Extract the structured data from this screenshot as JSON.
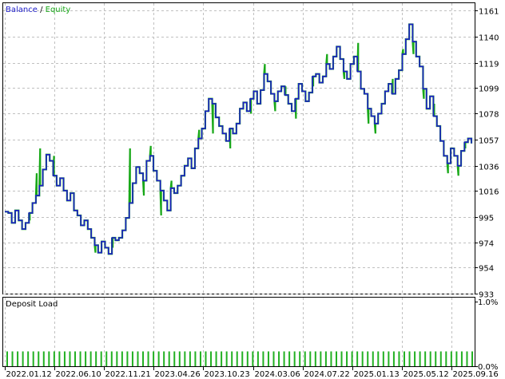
{
  "legend": {
    "balance_label": "Balance",
    "separator": " / ",
    "equity_label": "Equity",
    "balance_color": "#1c1cc8",
    "equity_color": "#18a818"
  },
  "panel2": {
    "title": "Deposit Load"
  },
  "colors": {
    "grid": "#c0c0c0",
    "axis": "#000000",
    "background": "#ffffff",
    "bar": "#22b022"
  },
  "chart_data": [
    {
      "type": "line",
      "title": "",
      "series_labels": [
        "Balance",
        "Equity"
      ],
      "ylim": [
        933,
        1167
      ],
      "yticks": [
        1161,
        1140,
        1119,
        1099,
        1078,
        1057,
        1036,
        1016,
        995,
        974,
        954,
        933
      ],
      "xticks": [
        "2022.01.12",
        "2022.06.10",
        "2022.11.21",
        "2023.04.26",
        "2023.10.23",
        "2024.03.06",
        "2024.07.22",
        "2025.01.13",
        "2025.05.12",
        "2025.09.16"
      ],
      "grid": true,
      "legend_position": "top-left",
      "balance_points": [
        [
          0,
          999
        ],
        [
          2,
          998
        ],
        [
          4,
          990
        ],
        [
          6,
          1000
        ],
        [
          8,
          992
        ],
        [
          10,
          985
        ],
        [
          12,
          990
        ],
        [
          14,
          998
        ],
        [
          16,
          1006
        ],
        [
          18,
          1012
        ],
        [
          20,
          1020
        ],
        [
          22,
          1033
        ],
        [
          24,
          1045
        ],
        [
          26,
          1040
        ],
        [
          28,
          1028
        ],
        [
          30,
          1020
        ],
        [
          32,
          1026
        ],
        [
          34,
          1016
        ],
        [
          36,
          1008
        ],
        [
          38,
          1014
        ],
        [
          40,
          1000
        ],
        [
          42,
          996
        ],
        [
          44,
          988
        ],
        [
          46,
          992
        ],
        [
          48,
          985
        ],
        [
          50,
          978
        ],
        [
          52,
          972
        ],
        [
          54,
          966
        ],
        [
          56,
          975
        ],
        [
          58,
          970
        ],
        [
          60,
          965
        ],
        [
          62,
          978
        ],
        [
          64,
          976
        ],
        [
          66,
          978
        ],
        [
          68,
          984
        ],
        [
          70,
          994
        ],
        [
          72,
          1006
        ],
        [
          74,
          1022
        ],
        [
          76,
          1035
        ],
        [
          78,
          1030
        ],
        [
          80,
          1024
        ],
        [
          82,
          1040
        ],
        [
          84,
          1044
        ],
        [
          86,
          1032
        ],
        [
          88,
          1024
        ],
        [
          90,
          1016
        ],
        [
          92,
          1008
        ],
        [
          94,
          1000
        ],
        [
          96,
          1018
        ],
        [
          98,
          1014
        ],
        [
          100,
          1020
        ],
        [
          102,
          1028
        ],
        [
          104,
          1036
        ],
        [
          106,
          1042
        ],
        [
          108,
          1034
        ],
        [
          110,
          1050
        ],
        [
          112,
          1058
        ],
        [
          114,
          1066
        ],
        [
          116,
          1080
        ],
        [
          118,
          1090
        ],
        [
          120,
          1086
        ],
        [
          122,
          1075
        ],
        [
          124,
          1068
        ],
        [
          126,
          1062
        ],
        [
          128,
          1056
        ],
        [
          130,
          1066
        ],
        [
          132,
          1062
        ],
        [
          134,
          1070
        ],
        [
          136,
          1082
        ],
        [
          138,
          1087
        ],
        [
          140,
          1080
        ],
        [
          142,
          1090
        ],
        [
          144,
          1096
        ],
        [
          146,
          1086
        ],
        [
          148,
          1097
        ],
        [
          150,
          1110
        ],
        [
          152,
          1104
        ],
        [
          154,
          1094
        ],
        [
          156,
          1088
        ],
        [
          158,
          1096
        ],
        [
          160,
          1100
        ],
        [
          162,
          1093
        ],
        [
          164,
          1086
        ],
        [
          166,
          1080
        ],
        [
          168,
          1090
        ],
        [
          170,
          1102
        ],
        [
          172,
          1096
        ],
        [
          174,
          1088
        ],
        [
          176,
          1095
        ],
        [
          178,
          1108
        ],
        [
          180,
          1110
        ],
        [
          182,
          1103
        ],
        [
          184,
          1108
        ],
        [
          186,
          1118
        ],
        [
          188,
          1114
        ],
        [
          190,
          1124
        ],
        [
          192,
          1132
        ],
        [
          194,
          1122
        ],
        [
          196,
          1112
        ],
        [
          198,
          1106
        ],
        [
          200,
          1118
        ],
        [
          202,
          1124
        ],
        [
          204,
          1112
        ],
        [
          206,
          1098
        ],
        [
          208,
          1094
        ],
        [
          210,
          1082
        ],
        [
          212,
          1076
        ],
        [
          214,
          1070
        ],
        [
          216,
          1078
        ],
        [
          218,
          1086
        ],
        [
          220,
          1096
        ],
        [
          222,
          1102
        ],
        [
          224,
          1094
        ],
        [
          226,
          1106
        ],
        [
          228,
          1113
        ],
        [
          230,
          1126
        ],
        [
          232,
          1138
        ],
        [
          234,
          1150
        ],
        [
          236,
          1136
        ],
        [
          238,
          1124
        ],
        [
          240,
          1116
        ],
        [
          242,
          1098
        ],
        [
          244,
          1082
        ],
        [
          246,
          1092
        ],
        [
          248,
          1076
        ],
        [
          250,
          1068
        ],
        [
          252,
          1056
        ],
        [
          254,
          1044
        ],
        [
          256,
          1038
        ],
        [
          258,
          1050
        ],
        [
          260,
          1044
        ],
        [
          262,
          1036
        ],
        [
          264,
          1048
        ],
        [
          266,
          1055
        ],
        [
          268,
          1058
        ],
        [
          270,
          1054
        ]
      ],
      "equity_extra_spikes": [
        [
          9,
          1007
        ],
        [
          14,
          992
        ],
        [
          18,
          1030
        ],
        [
          20,
          1050
        ],
        [
          23,
          1024
        ],
        [
          28,
          1044
        ],
        [
          35,
          1000
        ],
        [
          47,
          958
        ],
        [
          52,
          966
        ],
        [
          57,
          946
        ],
        [
          62,
          970
        ],
        [
          72,
          1050
        ],
        [
          75,
          1020
        ],
        [
          80,
          1012
        ],
        [
          84,
          1052
        ],
        [
          90,
          996
        ],
        [
          96,
          1024
        ],
        [
          112,
          1065
        ],
        [
          120,
          1062
        ],
        [
          130,
          1050
        ],
        [
          142,
          1078
        ],
        [
          150,
          1118
        ],
        [
          156,
          1080
        ],
        [
          162,
          1100
        ],
        [
          168,
          1074
        ],
        [
          178,
          1100
        ],
        [
          186,
          1126
        ],
        [
          196,
          1106
        ],
        [
          204,
          1135
        ],
        [
          210,
          1070
        ],
        [
          214,
          1062
        ],
        [
          224,
          1106
        ],
        [
          230,
          1130
        ],
        [
          236,
          1126
        ],
        [
          242,
          1090
        ],
        [
          248,
          1086
        ],
        [
          256,
          1030
        ],
        [
          262,
          1028
        ],
        [
          266,
          1050
        ]
      ]
    },
    {
      "type": "bar",
      "title": "Deposit Load",
      "ylim": [
        0,
        1.0
      ],
      "yticks": [
        "1.0%",
        "0.0%"
      ],
      "bar_height_pct": 0.36,
      "bar_count": 90
    }
  ]
}
